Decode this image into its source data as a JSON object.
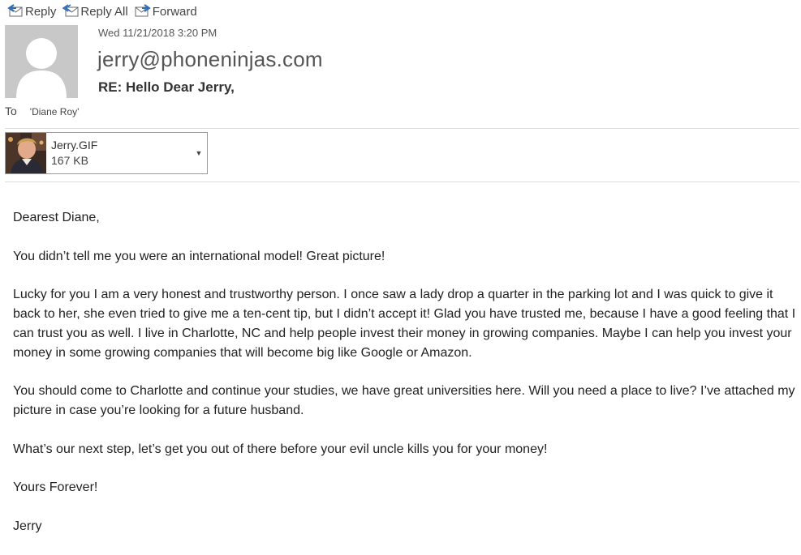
{
  "toolbar": {
    "reply_label": "Reply",
    "reply_all_label": "Reply All",
    "forward_label": "Forward"
  },
  "header": {
    "date": "Wed 11/21/2018 3:20 PM",
    "sender": "jerry@phoneninjas.com",
    "subject": "RE: Hello Dear Jerry,",
    "to_label": "To",
    "to_value": "'Diane Roy'"
  },
  "attachment": {
    "name": "Jerry.GIF",
    "size": "167 KB"
  },
  "body": {
    "greeting": "Dearest Diane,",
    "p1": "You didn’t tell me you were an international model! Great picture!",
    "p2": "Lucky for you I am a very honest and trustworthy person.  I once saw a lady drop a quarter in the parking lot and I was quick to give it back to her, she even tried to give me a ten-cent tip, but I didn’t accept it!  Glad you have trusted me, because I have a good feeling that I can trust you as well.  I live in Charlotte, NC and help people invest their money in growing companies.  Maybe I can help you invest your money in some growing companies that will become big like Google or Amazon.",
    "p3": "You should come to Charlotte and continue your studies, we have great universities here.  Will you need a place to live?  I’ve attached my picture in case you’re looking for a future husband.",
    "p4": "What’s our next step, let’s get you out of there before your evil uncle kills you for your money!",
    "closing": "Yours Forever!",
    "signature": "Jerry"
  }
}
